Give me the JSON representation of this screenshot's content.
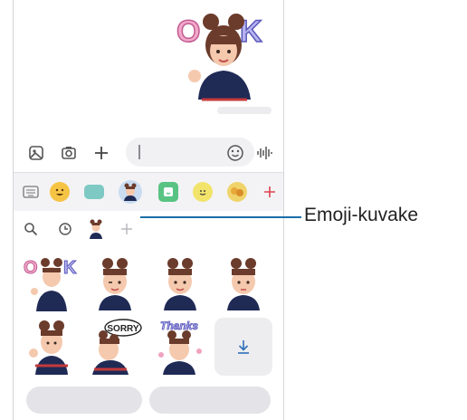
{
  "callout": {
    "label": "Emoji-kuvake"
  },
  "icons": {
    "gallery": "image-icon",
    "camera": "camera-icon",
    "attach": "plus-icon",
    "emoji": "smiley-icon",
    "voice": "voice-wave-icon",
    "search": "search-icon",
    "recent": "clock-icon",
    "ar_emoji": "ar-emoji-avatar-icon",
    "add": "plus-icon"
  },
  "emoji_tabs": [
    "keyboard",
    "emoji",
    "gif",
    "ar-emoji",
    "sticker",
    "bitmoji",
    "avatar-sticker",
    "add"
  ],
  "colors": {
    "accent": "#1a6ea8",
    "panel": "#f3f3f5",
    "selected_tab": "#c9dcf1"
  }
}
